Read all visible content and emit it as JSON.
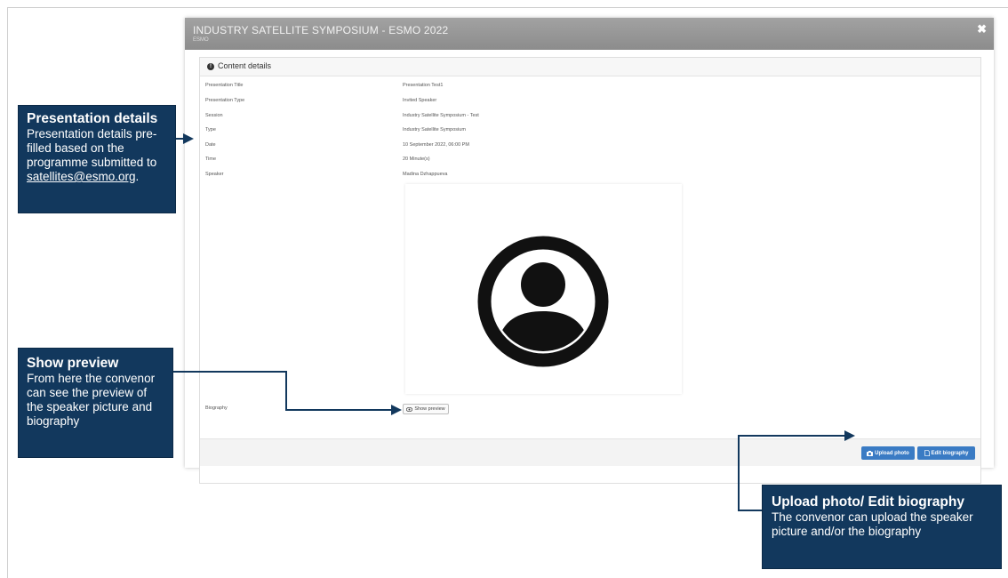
{
  "modal": {
    "title": "INDUSTRY SATELLITE SYMPOSIUM - ESMO 2022",
    "subtitle": "ESMO",
    "close_label": "✖"
  },
  "panel": {
    "title": "Content details",
    "rows": [
      {
        "label": "Presentation Title",
        "value": "Presentation Test1"
      },
      {
        "label": "Presentation Type",
        "value": "Invited Speaker"
      },
      {
        "label": "Session",
        "value": "Industry Satellite Symposium - Test"
      },
      {
        "label": "Type",
        "value": "Industry Satellite Symposium"
      },
      {
        "label": "Date",
        "value": "10 September 2022, 06:00 PM"
      },
      {
        "label": "Time",
        "value": "20 Minute(s)"
      },
      {
        "label": "Speaker",
        "value": "Madina Dzhappueva"
      }
    ],
    "biography_label": "Biography",
    "show_preview_label": "Show preview",
    "upload_photo_label": "Upload photo",
    "edit_biography_label": "Edit biography"
  },
  "callouts": {
    "presentation_details": {
      "title": "Presentation details",
      "body": "Presentation details pre-filled based on the programme submitted to",
      "link": "satellites@esmo.org",
      "after_link": "."
    },
    "show_preview": {
      "title": "Show preview",
      "body": "From here the convenor can see the preview of the speaker picture and biography"
    },
    "upload_edit": {
      "title": "Upload photo/ Edit biography",
      "body": "The convenor can upload the speaker picture and/or the biography"
    }
  },
  "colors": {
    "callout_bg": "#12385d",
    "button_blue": "#3a7bc4",
    "header_gray": "#999999"
  },
  "icons": {
    "info": "info-circle-icon",
    "eye": "eye-icon",
    "camera": "camera-icon",
    "file": "file-icon",
    "avatar": "user-avatar-icon",
    "close": "close-icon"
  }
}
